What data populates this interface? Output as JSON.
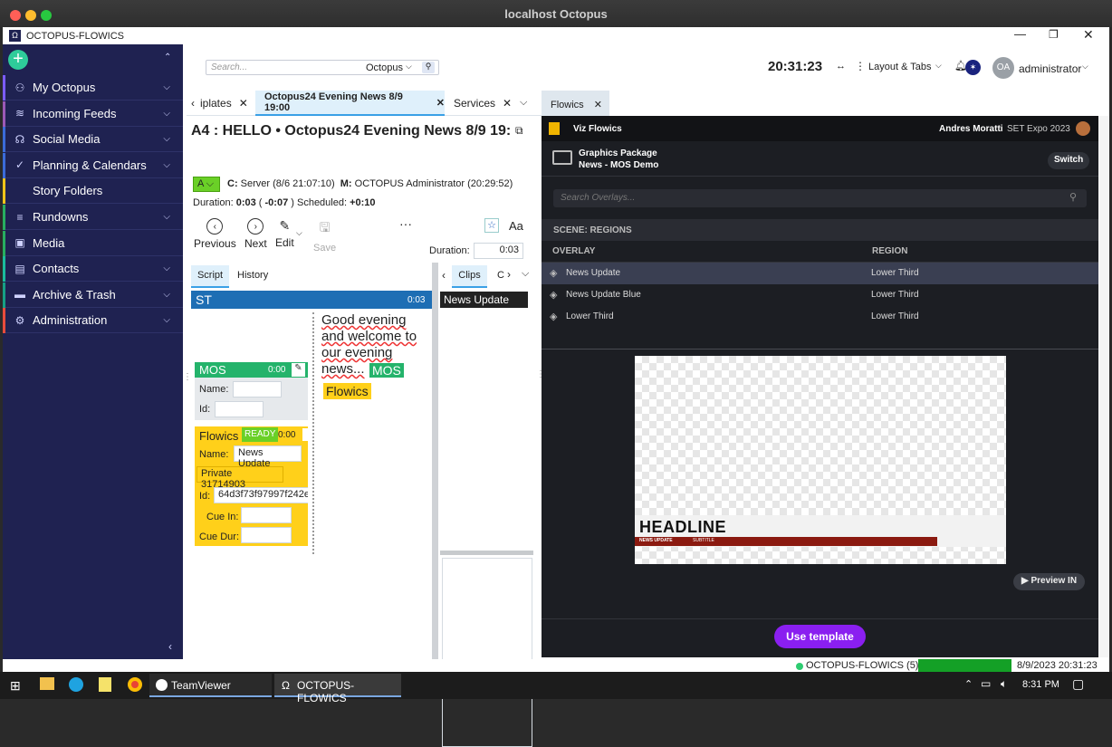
{
  "mac": {
    "title": "localhost Octopus"
  },
  "window": {
    "app_title": "OCTOPUS-FLOWICS"
  },
  "sidebar": {
    "items": [
      {
        "label": "My Octopus",
        "icon": "users-icon",
        "color": "#7b5cff"
      },
      {
        "label": "Incoming Feeds",
        "icon": "rss-icon",
        "color": "#9b59b6"
      },
      {
        "label": "Social Media",
        "icon": "chat-icon",
        "color": "#3b6bd8"
      },
      {
        "label": "Planning & Calendars",
        "icon": "check-icon",
        "color": "#3b6bd8"
      },
      {
        "label": "Story Folders",
        "icon": "folder-icon",
        "color": "#f0c419"
      },
      {
        "label": "Rundowns",
        "icon": "list-icon",
        "color": "#27ae60"
      },
      {
        "label": "Media",
        "icon": "media-icon",
        "color": "#27ae60"
      },
      {
        "label": "Contacts",
        "icon": "contact-icon",
        "color": "#1abc9c"
      },
      {
        "label": "Archive & Trash",
        "icon": "archive-icon",
        "color": "#16a085"
      },
      {
        "label": "Administration",
        "icon": "gear-icon",
        "color": "#e74c3c"
      }
    ]
  },
  "topbar": {
    "search_placeholder": "Search...",
    "search_scope": "Octopus",
    "clock": "20:31:23",
    "layout_label": "Layout & Tabs",
    "avatar": "OA",
    "user": "administrator"
  },
  "left_tabs": [
    {
      "label": "iplates"
    },
    {
      "label": "Octopus24 Evening News 8/9 19:00"
    },
    {
      "label": "Services"
    }
  ],
  "story": {
    "title": "A4 : HELLO • Octopus24 Evening News 8/9 19:",
    "status": "A",
    "created_label": "C:",
    "created_value": "Server (8/6 21:07:10)",
    "modified_label": "M:",
    "modified_value": "OCTOPUS Administrator (20:29:52)",
    "duration_label": "Duration:",
    "duration_value": "0:03",
    "diff": "-0:07",
    "scheduled_label": "Scheduled:",
    "scheduled_value": "+0:10",
    "toolbar": {
      "previous": "Previous",
      "next": "Next",
      "edit": "Edit",
      "save": "Save"
    },
    "duration_field_label": "Duration:",
    "duration_field_value": "0:03",
    "tabs": {
      "script": "Script",
      "history": "History"
    },
    "st_label": "ST",
    "st_time": "0:03",
    "mos": {
      "title": "MOS",
      "time": "0:00",
      "name_label": "Name:",
      "id_label": "Id:"
    },
    "flowics": {
      "title": "Flowics",
      "ready": "READY",
      "time": "0:00",
      "name_label": "Name:",
      "name_value": "News Update",
      "private": "Private 31714903",
      "id_label": "Id:",
      "id_value": "64d3f73f97997f242e",
      "cue_in_label": "Cue In:",
      "cue_dur_label": "Cue Dur:"
    },
    "script_text": "Good evening and welcome to our evening news...",
    "mos_tag": "MOS",
    "flowics_tag": "Flowics"
  },
  "clips": {
    "tab": "Clips",
    "tab2": "C",
    "item": "News Update"
  },
  "right": {
    "tab": "Flowics",
    "brand": "Viz Flowics",
    "user": "Andres Moratti",
    "event": "SET Expo 2023",
    "pkg_title": "Graphics Package",
    "pkg_sub": "News - MOS Demo",
    "switch": "Switch",
    "search_placeholder": "Search Overlays...",
    "scene": "SCENE: REGIONS",
    "col_overlay": "OVERLAY",
    "col_region": "REGION",
    "rows": [
      {
        "overlay": "News Update",
        "region": "Lower Third"
      },
      {
        "overlay": "News Update Blue",
        "region": "Lower Third"
      },
      {
        "overlay": "Lower Third",
        "region": "Lower Third"
      }
    ],
    "preview_headline": "HEADLINE",
    "preview_tag": "NEWS UPDATE",
    "preview_subtitle": "SUBTITLE",
    "preview_in": "Preview IN",
    "use_template": "Use template"
  },
  "status": {
    "server": "OCTOPUS-FLOWICS (5)",
    "datetime": "8/9/2023 20:31:23"
  },
  "taskbar": {
    "teamviewer": "TeamViewer",
    "octopus": "OCTOPUS-FLOWICS",
    "time": "8:31 PM"
  }
}
